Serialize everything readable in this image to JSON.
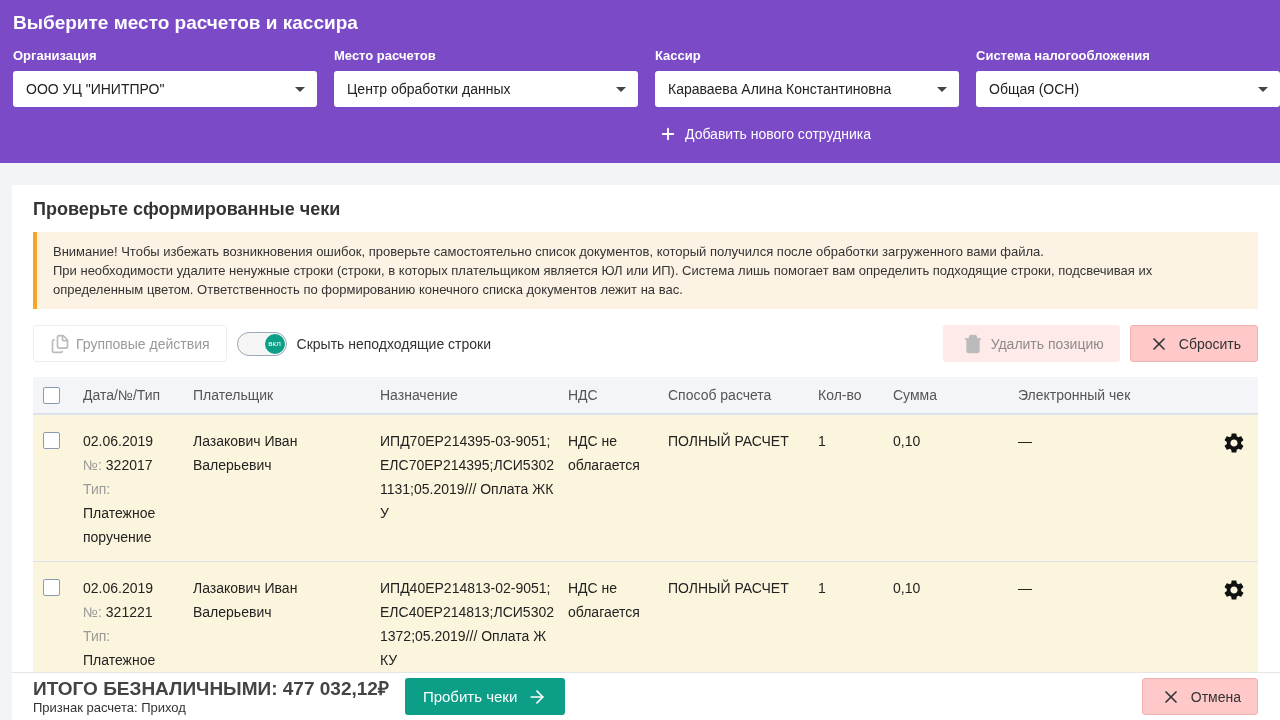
{
  "header": {
    "title": "Выберите место расчетов и кассира",
    "fields": [
      {
        "label": "Организация",
        "value": "ООО УЦ \"ИНИТПРО\""
      },
      {
        "label": "Место расчетов",
        "value": "Центр обработки данных"
      },
      {
        "label": "Кассир",
        "value": "Караваева Алина Константиновна"
      },
      {
        "label": "Система налогообложения",
        "value": "Общая (ОСН)"
      }
    ],
    "add_employee": "Добавить нового сотрудника"
  },
  "section": {
    "title": "Проверьте сформированные чеки",
    "warning": [
      "Внимание! Чтобы избежать возникновения ошибок, проверьте самостоятельно список документов, который получился после обработки загруженного вами файла.",
      "При необходимости удалите ненужные строки (строки, в которых плательщиком является ЮЛ или ИП). Система лишь помогает вам определить подходящие строки, подсвечивая их определенным цветом. Ответственность по формированию конечного списка документов лежит на вас."
    ]
  },
  "toolbar": {
    "group_actions": {
      "label": "Групповые действия",
      "disabled": true
    },
    "toggle": {
      "knob": "вкл",
      "label": "Скрыть неподходящие строки",
      "on": true
    },
    "delete": {
      "label": "Удалить позицию",
      "disabled": true
    },
    "reset": {
      "label": "Сбросить"
    }
  },
  "table": {
    "header_checked": false,
    "columns": [
      "Дата/№/Тип",
      "Плательщик",
      "Назначение",
      "НДС",
      "Способ расчета",
      "Кол-во",
      "Сумма",
      "Электронный чек"
    ],
    "rows": [
      {
        "checked": false,
        "date": "02.06.2019",
        "number_label": "№:",
        "number": "322017",
        "type_label": "Тип:",
        "type": "Платежное поручение",
        "payer": "Лазакович Иван Валерьевич",
        "purpose": "ИПД70ЕР214395-03-9051;ЕЛС70ЕР214395;ЛСИ53021131;05.2019/// Оплата ЖКУ",
        "vat": "НДС не облагается",
        "method": "ПОЛНЫЙ РАСЧЕТ",
        "qty": "1",
        "sum": "0,10",
        "receipt": "—"
      },
      {
        "checked": false,
        "date": "02.06.2019",
        "number_label": "№:",
        "number": "321221",
        "type_label": "Тип:",
        "type": "Платежное",
        "payer": "Лазакович Иван Валерьевич",
        "purpose": "ИПД40ЕР214813-02-9051;ЕЛС40ЕР214813;ЛСИ53021372;05.2019/// Оплата ЖКУ",
        "vat": "НДС не облагается",
        "method": "ПОЛНЫЙ РАСЧЕТ",
        "qty": "1",
        "sum": "0,10",
        "receipt": "—"
      }
    ]
  },
  "footer": {
    "total": "ИТОГО БЕЗНАЛИЧНЫМИ: 477 032,12₽",
    "sign": "Признак расчета: Приход",
    "submit": "Пробить чеки",
    "cancel": "Отмена"
  }
}
